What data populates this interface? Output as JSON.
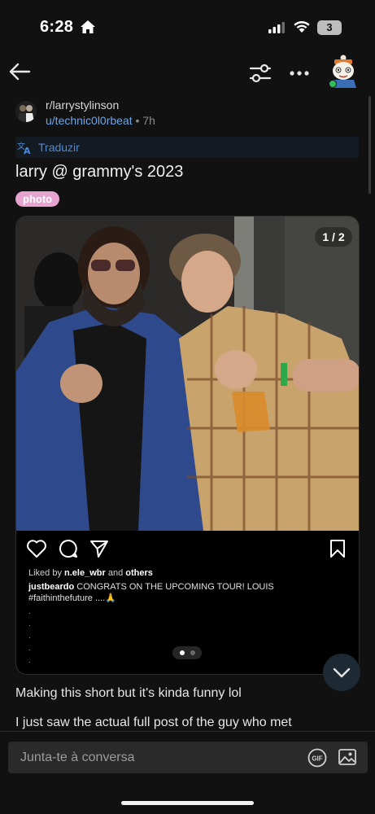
{
  "status_bar": {
    "time": "6:28",
    "battery": "3"
  },
  "post": {
    "community": "r/larrystylinson",
    "author": "u/technic0l0rbeat",
    "separator": "•",
    "age": "7h",
    "translate_label": "Traduzir",
    "title": "larry @ grammy's 2023",
    "flair": "photo",
    "body_line_1": "Making this short but it's kinda funny lol",
    "body_line_2": "I just saw the actual full post of the guy who met"
  },
  "media": {
    "page_indicator": "1 / 2",
    "liked_by_prefix": "Liked by ",
    "liked_by_user": "n.ele_wbr",
    "liked_by_middle": " and ",
    "liked_by_others": "others",
    "caption_user": "justbeardo",
    "caption_text": " CONGRATS ON THE UPCOMING TOUR!  LOUIS",
    "caption_hashtag": "#faithinthefuture ....🙏",
    "caption_dots": [
      ".",
      ".",
      ".",
      ".",
      ".",
      "."
    ]
  },
  "composer": {
    "placeholder": "Junta-te à conversa",
    "gif_label": "GIF"
  },
  "icons": {
    "back": "arrow-left-icon",
    "filter": "sliders-icon",
    "more": "ellipsis-icon",
    "translate": "translate-icon",
    "like": "heart-icon",
    "comment": "comment-icon",
    "share": "send-icon",
    "save": "bookmark-icon",
    "scroll_down": "chevron-down-icon",
    "image": "image-icon"
  },
  "colors": {
    "background": "#111111",
    "link_blue": "#6fa4e6",
    "flair_pink": "#e8a4d0",
    "online_green": "#2fbd5c"
  }
}
